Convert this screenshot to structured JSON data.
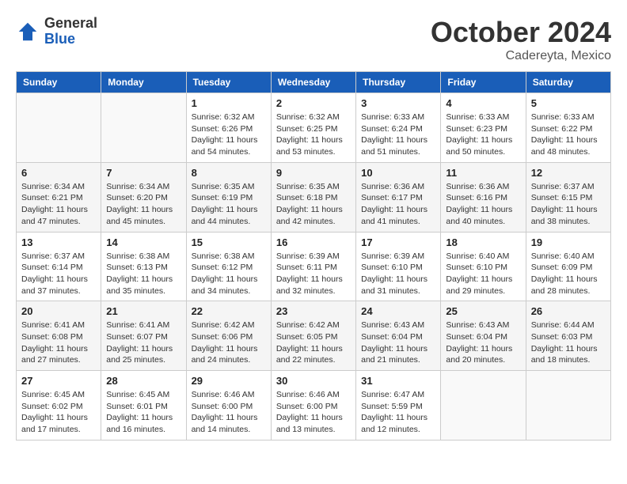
{
  "header": {
    "logo_general": "General",
    "logo_blue": "Blue",
    "month_title": "October 2024",
    "location": "Cadereyta, Mexico"
  },
  "weekdays": [
    "Sunday",
    "Monday",
    "Tuesday",
    "Wednesday",
    "Thursday",
    "Friday",
    "Saturday"
  ],
  "weeks": [
    [
      {
        "day": "",
        "sunrise": "",
        "sunset": "",
        "daylight": ""
      },
      {
        "day": "",
        "sunrise": "",
        "sunset": "",
        "daylight": ""
      },
      {
        "day": "1",
        "sunrise": "Sunrise: 6:32 AM",
        "sunset": "Sunset: 6:26 PM",
        "daylight": "Daylight: 11 hours and 54 minutes."
      },
      {
        "day": "2",
        "sunrise": "Sunrise: 6:32 AM",
        "sunset": "Sunset: 6:25 PM",
        "daylight": "Daylight: 11 hours and 53 minutes."
      },
      {
        "day": "3",
        "sunrise": "Sunrise: 6:33 AM",
        "sunset": "Sunset: 6:24 PM",
        "daylight": "Daylight: 11 hours and 51 minutes."
      },
      {
        "day": "4",
        "sunrise": "Sunrise: 6:33 AM",
        "sunset": "Sunset: 6:23 PM",
        "daylight": "Daylight: 11 hours and 50 minutes."
      },
      {
        "day": "5",
        "sunrise": "Sunrise: 6:33 AM",
        "sunset": "Sunset: 6:22 PM",
        "daylight": "Daylight: 11 hours and 48 minutes."
      }
    ],
    [
      {
        "day": "6",
        "sunrise": "Sunrise: 6:34 AM",
        "sunset": "Sunset: 6:21 PM",
        "daylight": "Daylight: 11 hours and 47 minutes."
      },
      {
        "day": "7",
        "sunrise": "Sunrise: 6:34 AM",
        "sunset": "Sunset: 6:20 PM",
        "daylight": "Daylight: 11 hours and 45 minutes."
      },
      {
        "day": "8",
        "sunrise": "Sunrise: 6:35 AM",
        "sunset": "Sunset: 6:19 PM",
        "daylight": "Daylight: 11 hours and 44 minutes."
      },
      {
        "day": "9",
        "sunrise": "Sunrise: 6:35 AM",
        "sunset": "Sunset: 6:18 PM",
        "daylight": "Daylight: 11 hours and 42 minutes."
      },
      {
        "day": "10",
        "sunrise": "Sunrise: 6:36 AM",
        "sunset": "Sunset: 6:17 PM",
        "daylight": "Daylight: 11 hours and 41 minutes."
      },
      {
        "day": "11",
        "sunrise": "Sunrise: 6:36 AM",
        "sunset": "Sunset: 6:16 PM",
        "daylight": "Daylight: 11 hours and 40 minutes."
      },
      {
        "day": "12",
        "sunrise": "Sunrise: 6:37 AM",
        "sunset": "Sunset: 6:15 PM",
        "daylight": "Daylight: 11 hours and 38 minutes."
      }
    ],
    [
      {
        "day": "13",
        "sunrise": "Sunrise: 6:37 AM",
        "sunset": "Sunset: 6:14 PM",
        "daylight": "Daylight: 11 hours and 37 minutes."
      },
      {
        "day": "14",
        "sunrise": "Sunrise: 6:38 AM",
        "sunset": "Sunset: 6:13 PM",
        "daylight": "Daylight: 11 hours and 35 minutes."
      },
      {
        "day": "15",
        "sunrise": "Sunrise: 6:38 AM",
        "sunset": "Sunset: 6:12 PM",
        "daylight": "Daylight: 11 hours and 34 minutes."
      },
      {
        "day": "16",
        "sunrise": "Sunrise: 6:39 AM",
        "sunset": "Sunset: 6:11 PM",
        "daylight": "Daylight: 11 hours and 32 minutes."
      },
      {
        "day": "17",
        "sunrise": "Sunrise: 6:39 AM",
        "sunset": "Sunset: 6:10 PM",
        "daylight": "Daylight: 11 hours and 31 minutes."
      },
      {
        "day": "18",
        "sunrise": "Sunrise: 6:40 AM",
        "sunset": "Sunset: 6:10 PM",
        "daylight": "Daylight: 11 hours and 29 minutes."
      },
      {
        "day": "19",
        "sunrise": "Sunrise: 6:40 AM",
        "sunset": "Sunset: 6:09 PM",
        "daylight": "Daylight: 11 hours and 28 minutes."
      }
    ],
    [
      {
        "day": "20",
        "sunrise": "Sunrise: 6:41 AM",
        "sunset": "Sunset: 6:08 PM",
        "daylight": "Daylight: 11 hours and 27 minutes."
      },
      {
        "day": "21",
        "sunrise": "Sunrise: 6:41 AM",
        "sunset": "Sunset: 6:07 PM",
        "daylight": "Daylight: 11 hours and 25 minutes."
      },
      {
        "day": "22",
        "sunrise": "Sunrise: 6:42 AM",
        "sunset": "Sunset: 6:06 PM",
        "daylight": "Daylight: 11 hours and 24 minutes."
      },
      {
        "day": "23",
        "sunrise": "Sunrise: 6:42 AM",
        "sunset": "Sunset: 6:05 PM",
        "daylight": "Daylight: 11 hours and 22 minutes."
      },
      {
        "day": "24",
        "sunrise": "Sunrise: 6:43 AM",
        "sunset": "Sunset: 6:04 PM",
        "daylight": "Daylight: 11 hours and 21 minutes."
      },
      {
        "day": "25",
        "sunrise": "Sunrise: 6:43 AM",
        "sunset": "Sunset: 6:04 PM",
        "daylight": "Daylight: 11 hours and 20 minutes."
      },
      {
        "day": "26",
        "sunrise": "Sunrise: 6:44 AM",
        "sunset": "Sunset: 6:03 PM",
        "daylight": "Daylight: 11 hours and 18 minutes."
      }
    ],
    [
      {
        "day": "27",
        "sunrise": "Sunrise: 6:45 AM",
        "sunset": "Sunset: 6:02 PM",
        "daylight": "Daylight: 11 hours and 17 minutes."
      },
      {
        "day": "28",
        "sunrise": "Sunrise: 6:45 AM",
        "sunset": "Sunset: 6:01 PM",
        "daylight": "Daylight: 11 hours and 16 minutes."
      },
      {
        "day": "29",
        "sunrise": "Sunrise: 6:46 AM",
        "sunset": "Sunset: 6:00 PM",
        "daylight": "Daylight: 11 hours and 14 minutes."
      },
      {
        "day": "30",
        "sunrise": "Sunrise: 6:46 AM",
        "sunset": "Sunset: 6:00 PM",
        "daylight": "Daylight: 11 hours and 13 minutes."
      },
      {
        "day": "31",
        "sunrise": "Sunrise: 6:47 AM",
        "sunset": "Sunset: 5:59 PM",
        "daylight": "Daylight: 11 hours and 12 minutes."
      },
      {
        "day": "",
        "sunrise": "",
        "sunset": "",
        "daylight": ""
      },
      {
        "day": "",
        "sunrise": "",
        "sunset": "",
        "daylight": ""
      }
    ]
  ]
}
